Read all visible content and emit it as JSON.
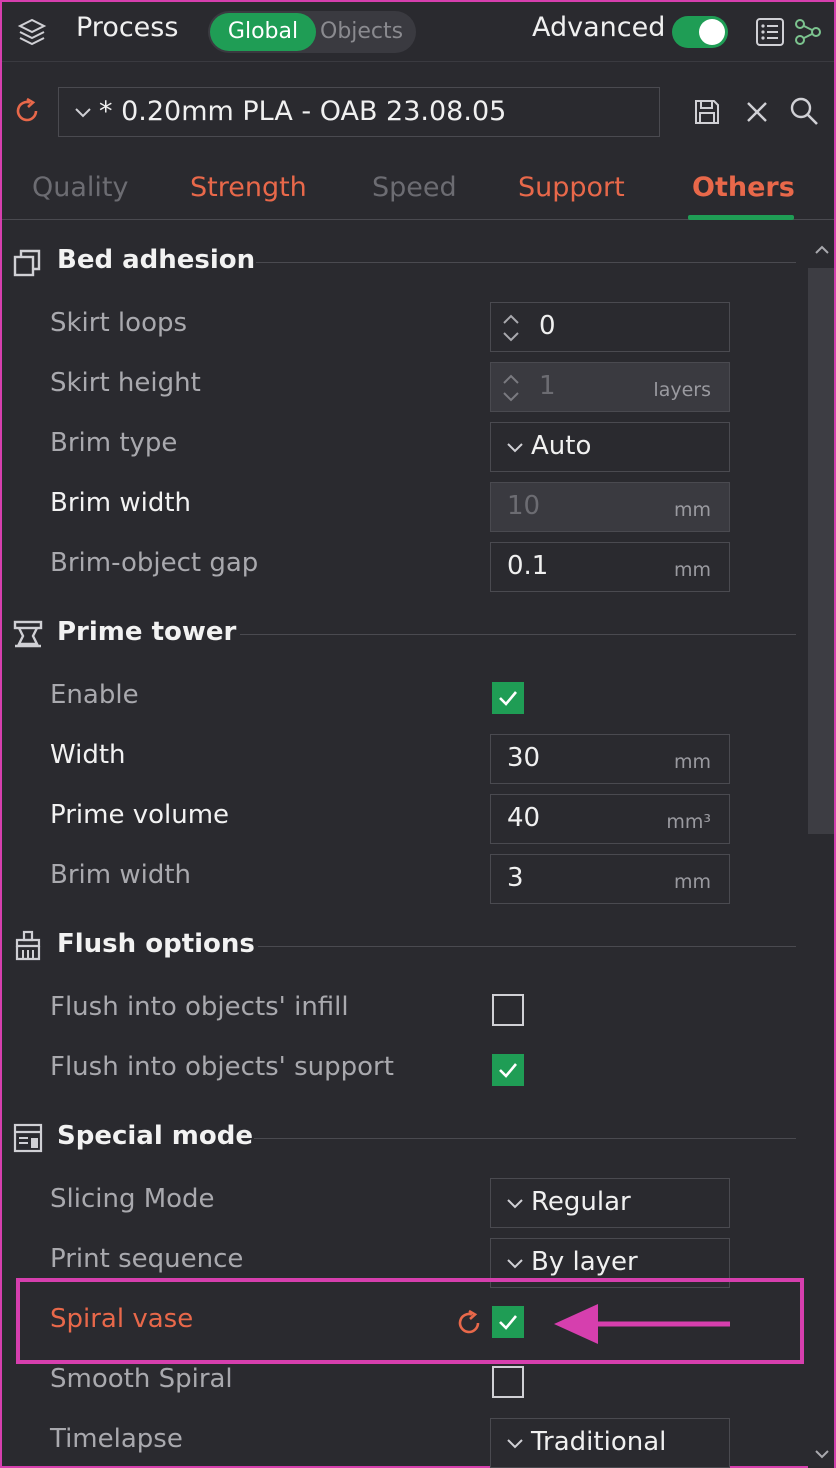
{
  "header": {
    "title": "Process",
    "seg_global": "Global",
    "seg_objects": "Objects",
    "advanced_label": "Advanced"
  },
  "preset": {
    "name": "* 0.20mm PLA - OAB 23.08.05"
  },
  "tabs": [
    {
      "label": "Quality",
      "state": "inactive"
    },
    {
      "label": "Strength",
      "state": "modified"
    },
    {
      "label": "Speed",
      "state": "inactive"
    },
    {
      "label": "Support",
      "state": "modified"
    },
    {
      "label": "Others",
      "state": "active"
    }
  ],
  "sections": {
    "bed_adhesion": "Bed adhesion",
    "prime_tower": "Prime tower",
    "flush_options": "Flush options",
    "special_mode": "Special mode"
  },
  "rows": {
    "skirt_loops": {
      "label": "Skirt loops",
      "value": "0"
    },
    "skirt_height": {
      "label": "Skirt height",
      "value": "1",
      "unit": "layers"
    },
    "brim_type": {
      "label": "Brim type",
      "value": "Auto"
    },
    "brim_width": {
      "label": "Brim width",
      "value": "10",
      "unit": "mm"
    },
    "brim_object_gap": {
      "label": "Brim-object gap",
      "value": "0.1",
      "unit": "mm"
    },
    "enable": {
      "label": "Enable",
      "checked": true
    },
    "width": {
      "label": "Width",
      "value": "30",
      "unit": "mm"
    },
    "prime_volume": {
      "label": "Prime volume",
      "value": "40",
      "unit": "mm³"
    },
    "tower_brim_width": {
      "label": "Brim width",
      "value": "3",
      "unit": "mm"
    },
    "flush_infill": {
      "label": "Flush into objects' infill",
      "checked": false
    },
    "flush_support": {
      "label": "Flush into objects' support",
      "checked": true
    },
    "slicing_mode": {
      "label": "Slicing Mode",
      "value": "Regular"
    },
    "print_sequence": {
      "label": "Print sequence",
      "value": "By layer"
    },
    "spiral_vase": {
      "label": "Spiral vase",
      "checked": true
    },
    "smooth_spiral": {
      "label": "Smooth Spiral",
      "checked": false
    },
    "timelapse": {
      "label": "Timelapse",
      "value": "Traditional"
    }
  },
  "colors": {
    "accent_green": "#1f9d55",
    "modified_orange": "#e8684a",
    "highlight_magenta": "#d63fae",
    "background": "#2a2a2f"
  }
}
